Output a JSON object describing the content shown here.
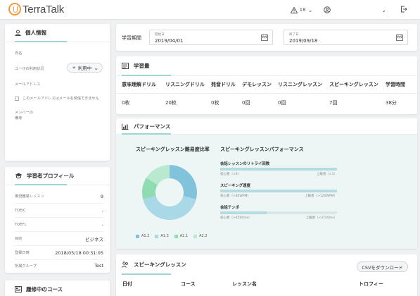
{
  "app": {
    "name": "TerraTalk"
  },
  "header": {
    "alert_count": "18"
  },
  "personal": {
    "title": "個人情報",
    "name_label": "氏名",
    "status_label": "ユーザの利用状況",
    "status_value": "利用中",
    "email_label": "メールアドレス",
    "email_optout": "このメールアドレスはメールを受信できません",
    "memo_label": "メンバーの\n備考"
  },
  "profile": {
    "title": "学習者プロフィール",
    "rows": [
      {
        "k": "推奨難易レッスン",
        "v": "9"
      },
      {
        "k": "TOEIC",
        "v": "-"
      },
      {
        "k": "TOEFL",
        "v": "-"
      },
      {
        "k": "目的",
        "v": "ビジネス"
      },
      {
        "k": "登録日時",
        "v": "2018/05/18 00:31:05"
      },
      {
        "k": "所属グループ",
        "v": "Test"
      }
    ]
  },
  "courses": {
    "title": "履修中のコース"
  },
  "period": {
    "label": "学習期間",
    "start_label": "開始日",
    "start_value": "2019/04/01",
    "end_label": "終了日",
    "end_value": "2019/09/18"
  },
  "volume": {
    "title": "学習量",
    "headers": [
      "意味理解ドリル",
      "リスニングドリル",
      "発音ドリル",
      "デモレッスン",
      "リスニングレッスン",
      "スピーキングレッスン",
      "学習時間"
    ],
    "values": [
      "0枚",
      "20枚",
      "0枚",
      "0回",
      "0回",
      "7回",
      "38分"
    ]
  },
  "performance": {
    "title": "パフォーマンス",
    "chart_title": "スピーキングレッスン難易度比率",
    "metrics_title": "スピーキングレッスンパフォーマンス",
    "metrics": [
      {
        "name": "会話レッスンのリトライ回数",
        "left": "初心者（×6）",
        "right": "上級者（×1）",
        "fill": 1.0
      },
      {
        "name": "スピーキング速度",
        "left": "初心者（<80WPM）",
        "right": "上級者（>120WPM）",
        "fill": 1.0
      },
      {
        "name": "会話テンポ",
        "left": "初心者（>4500ms）",
        "right": "上級者（<3750ms）",
        "fill": 0.4
      }
    ]
  },
  "chart_data": {
    "type": "pie",
    "title": "スピーキングレッスン難易度比率",
    "categories": [
      "A1.2",
      "A1.3",
      "A2.1",
      "A2.2"
    ],
    "values": [
      29,
      42,
      13,
      16
    ],
    "colors": [
      "#82c3dc",
      "#a9d9e6",
      "#8fdcb3",
      "#b9ead0"
    ]
  },
  "speaking": {
    "title": "スピーキングレッスン",
    "csv_label": "CSVをダウンロード",
    "headers": [
      "日付",
      "コース",
      "レッスン名",
      "トロフィー"
    ]
  }
}
